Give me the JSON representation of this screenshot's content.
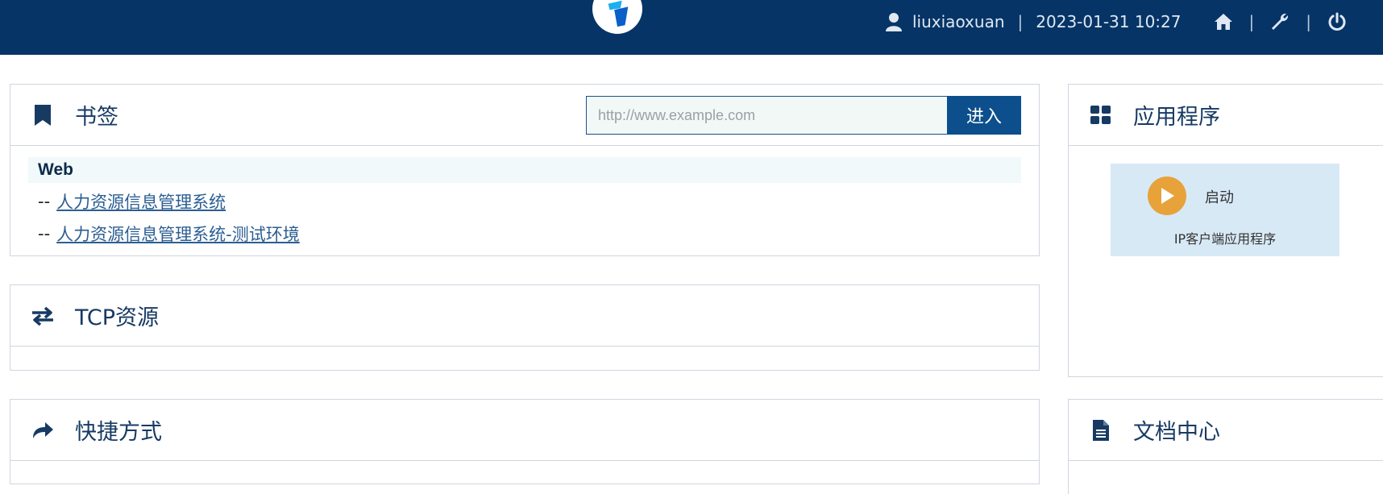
{
  "header": {
    "username": "liuxiaoxuan",
    "separator": "|",
    "datetime": "2023-01-31 10:27",
    "icons": [
      "user-icon",
      "home-icon",
      "wrench-icon",
      "power-icon"
    ],
    "bg_color": "#063466"
  },
  "bookmarks": {
    "title": "书签",
    "url_placeholder": "http://www.example.com",
    "url_value": "",
    "go_label": "进入",
    "group_name": "Web",
    "link_prefix": "--",
    "links": [
      "人力资源信息管理系统",
      "人力资源信息管理系统-测试环境"
    ]
  },
  "tcp": {
    "title": "TCP资源"
  },
  "shortcuts": {
    "title": "快捷方式"
  },
  "apps": {
    "title": "应用程序",
    "tile": {
      "launch_label": "启动",
      "name": "IP客户端应用程序"
    }
  },
  "docs": {
    "title": "文档中心"
  }
}
